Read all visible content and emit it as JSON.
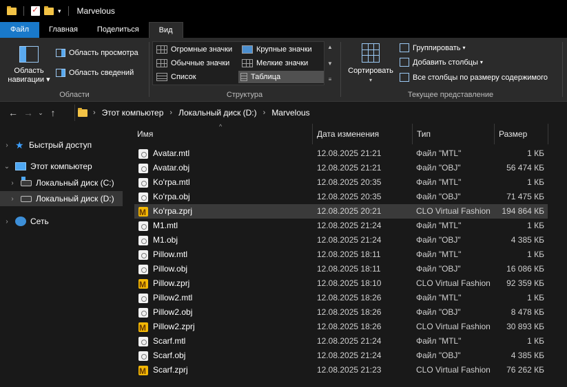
{
  "window": {
    "title": "Marvelous"
  },
  "ribbon": {
    "tabs": [
      "Файл",
      "Главная",
      "Поделиться",
      "Вид"
    ],
    "panes": {
      "nav_pane_label_1": "Область",
      "nav_pane_label_2": "навигации",
      "preview": "Область просмотра",
      "details": "Область сведений",
      "group": "Области"
    },
    "layout": {
      "huge": "Огромные значки",
      "large": "Крупные значки",
      "normal": "Обычные значки",
      "small": "Мелкие значки",
      "list": "Список",
      "table": "Таблица",
      "group": "Структура"
    },
    "current_view": {
      "sort": "Сортировать",
      "group_by": "Группировать",
      "add_columns": "Добавить столбцы",
      "fit_columns": "Все столбцы по размеру содержимого",
      "group": "Текущее представление"
    }
  },
  "address": {
    "crumbs": [
      "Этот компьютер",
      "Локальный диск (D:)",
      "Marvelous"
    ]
  },
  "nav": {
    "quick_access": "Быстрый доступ",
    "this_pc": "Этот компьютер",
    "disk_c": "Локальный диск (C:)",
    "disk_d": "Локальный диск (D:)",
    "network": "Сеть"
  },
  "columns": {
    "name": "Имя",
    "date": "Дата изменения",
    "type": "Тип",
    "size": "Размер"
  },
  "files": [
    {
      "name": "Avatar.mtl",
      "date": "12.08.2025 21:21",
      "type": "Файл \"MTL\"",
      "size": "1 КБ",
      "icon": "doc"
    },
    {
      "name": "Avatar.obj",
      "date": "12.08.2025 21:21",
      "type": "Файл \"OBJ\"",
      "size": "56 474 КБ",
      "icon": "doc"
    },
    {
      "name": "Ko'rpa.mtl",
      "date": "12.08.2025 20:35",
      "type": "Файл \"MTL\"",
      "size": "1 КБ",
      "icon": "doc"
    },
    {
      "name": "Ko'rpa.obj",
      "date": "12.08.2025 20:35",
      "type": "Файл \"OBJ\"",
      "size": "71 475 КБ",
      "icon": "doc"
    },
    {
      "name": "Ko'rpa.zprj",
      "date": "12.08.2025 20:21",
      "type": "CLO Virtual Fashion",
      "size": "194 864 КБ",
      "icon": "zprj"
    },
    {
      "name": "M1.mtl",
      "date": "12.08.2025 21:24",
      "type": "Файл \"MTL\"",
      "size": "1 КБ",
      "icon": "doc"
    },
    {
      "name": "M1.obj",
      "date": "12.08.2025 21:24",
      "type": "Файл \"OBJ\"",
      "size": "4 385 КБ",
      "icon": "doc"
    },
    {
      "name": "Pillow.mtl",
      "date": "12.08.2025 18:11",
      "type": "Файл \"MTL\"",
      "size": "1 КБ",
      "icon": "doc"
    },
    {
      "name": "Pillow.obj",
      "date": "12.08.2025 18:11",
      "type": "Файл \"OBJ\"",
      "size": "16 086 КБ",
      "icon": "doc"
    },
    {
      "name": "Pillow.zprj",
      "date": "12.08.2025 18:10",
      "type": "CLO Virtual Fashion",
      "size": "92 359 КБ",
      "icon": "zprj"
    },
    {
      "name": "Pillow2.mtl",
      "date": "12.08.2025 18:26",
      "type": "Файл \"MTL\"",
      "size": "1 КБ",
      "icon": "doc"
    },
    {
      "name": "Pillow2.obj",
      "date": "12.08.2025 18:26",
      "type": "Файл \"OBJ\"",
      "size": "8 478 КБ",
      "icon": "doc"
    },
    {
      "name": "Pillow2.zprj",
      "date": "12.08.2025 18:26",
      "type": "CLO Virtual Fashion",
      "size": "30 893 КБ",
      "icon": "zprj"
    },
    {
      "name": "Scarf.mtl",
      "date": "12.08.2025 21:24",
      "type": "Файл \"MTL\"",
      "size": "1 КБ",
      "icon": "doc"
    },
    {
      "name": "Scarf.obj",
      "date": "12.08.2025 21:24",
      "type": "Файл \"OBJ\"",
      "size": "4 385 КБ",
      "icon": "doc"
    },
    {
      "name": "Scarf.zprj",
      "date": "12.08.2025 21:23",
      "type": "CLO Virtual Fashion",
      "size": "76 262 КБ",
      "icon": "zprj"
    }
  ],
  "selected_file": "Ko'rpa.zprj",
  "colors": {
    "accent": "#1979ca",
    "background": "#191919",
    "ribbon": "#2b2b2b",
    "selection": "#3a3a3a"
  }
}
